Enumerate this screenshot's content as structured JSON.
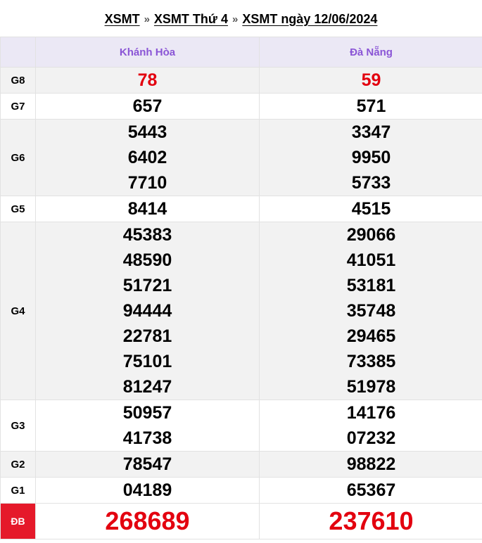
{
  "breadcrumb": {
    "item1": "XSMT",
    "item2": "XSMT Thứ 4",
    "item3": "XSMT ngày 12/06/2024",
    "separator": "»"
  },
  "table": {
    "provinces": [
      "Khánh Hòa",
      "Đà Nẵng"
    ],
    "rows": [
      {
        "prize": "G8",
        "values": [
          [
            "78"
          ],
          [
            "59"
          ]
        ]
      },
      {
        "prize": "G7",
        "values": [
          [
            "657"
          ],
          [
            "571"
          ]
        ]
      },
      {
        "prize": "G6",
        "values": [
          [
            "5443",
            "6402",
            "7710"
          ],
          [
            "3347",
            "9950",
            "5733"
          ]
        ]
      },
      {
        "prize": "G5",
        "values": [
          [
            "8414"
          ],
          [
            "4515"
          ]
        ]
      },
      {
        "prize": "G4",
        "values": [
          [
            "45383",
            "48590",
            "51721",
            "94444",
            "22781",
            "75101",
            "81247"
          ],
          [
            "29066",
            "41051",
            "53181",
            "35748",
            "29465",
            "73385",
            "51978"
          ]
        ]
      },
      {
        "prize": "G3",
        "values": [
          [
            "50957",
            "41738"
          ],
          [
            "14176",
            "07232"
          ]
        ]
      },
      {
        "prize": "G2",
        "values": [
          [
            "78547"
          ],
          [
            "98822"
          ]
        ]
      },
      {
        "prize": "G1",
        "values": [
          [
            "04189"
          ],
          [
            "65367"
          ]
        ]
      },
      {
        "prize": "ĐB",
        "values": [
          [
            "268689"
          ],
          [
            "237610"
          ]
        ]
      }
    ]
  },
  "colors": {
    "header_text": "#8a55d6",
    "header_bg": "#ebe8f5",
    "stripe_bg": "#f2f2f2",
    "highlight_red": "#e3000f",
    "special_label_bg": "#e5192a"
  }
}
